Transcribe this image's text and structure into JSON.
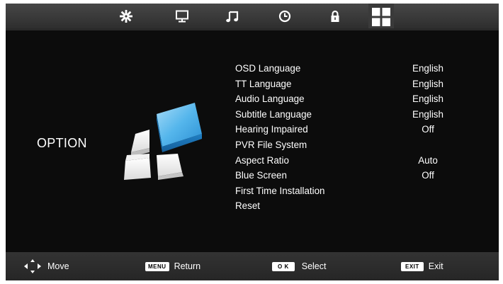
{
  "tabs": [
    {
      "name": "picture-settings-icon"
    },
    {
      "name": "tv-channel-icon"
    },
    {
      "name": "music-sound-icon"
    },
    {
      "name": "clock-time-icon"
    },
    {
      "name": "lock-icon"
    },
    {
      "name": "option-grid-icon",
      "selected": true
    }
  ],
  "page": {
    "title": "OPTION",
    "icon": "option-blocks-icon"
  },
  "menu": {
    "items": [
      {
        "label": "OSD Language",
        "value": "English"
      },
      {
        "label": "TT Language",
        "value": "English"
      },
      {
        "label": "Audio Language",
        "value": "English"
      },
      {
        "label": "Subtitle Language",
        "value": "English"
      },
      {
        "label": "Hearing Impaired",
        "value": "Off"
      },
      {
        "label": "PVR File System",
        "value": ""
      },
      {
        "label": "Aspect Ratio",
        "value": "Auto"
      },
      {
        "label": "Blue Screen",
        "value": "Off"
      },
      {
        "label": "First Time Installation",
        "value": ""
      },
      {
        "label": "Reset",
        "value": ""
      }
    ]
  },
  "footer": {
    "move_label": "Move",
    "menu_key": "MENU",
    "return_label": "Return",
    "ok_key": "O K",
    "select_label": "Select",
    "exit_key": "EXIT",
    "exit_label": "Exit"
  },
  "colors": {
    "background": "#0c0c0c",
    "bar": "#3a3a3a",
    "accent_blue": "#3aa0e0",
    "text": "#ffffff"
  }
}
